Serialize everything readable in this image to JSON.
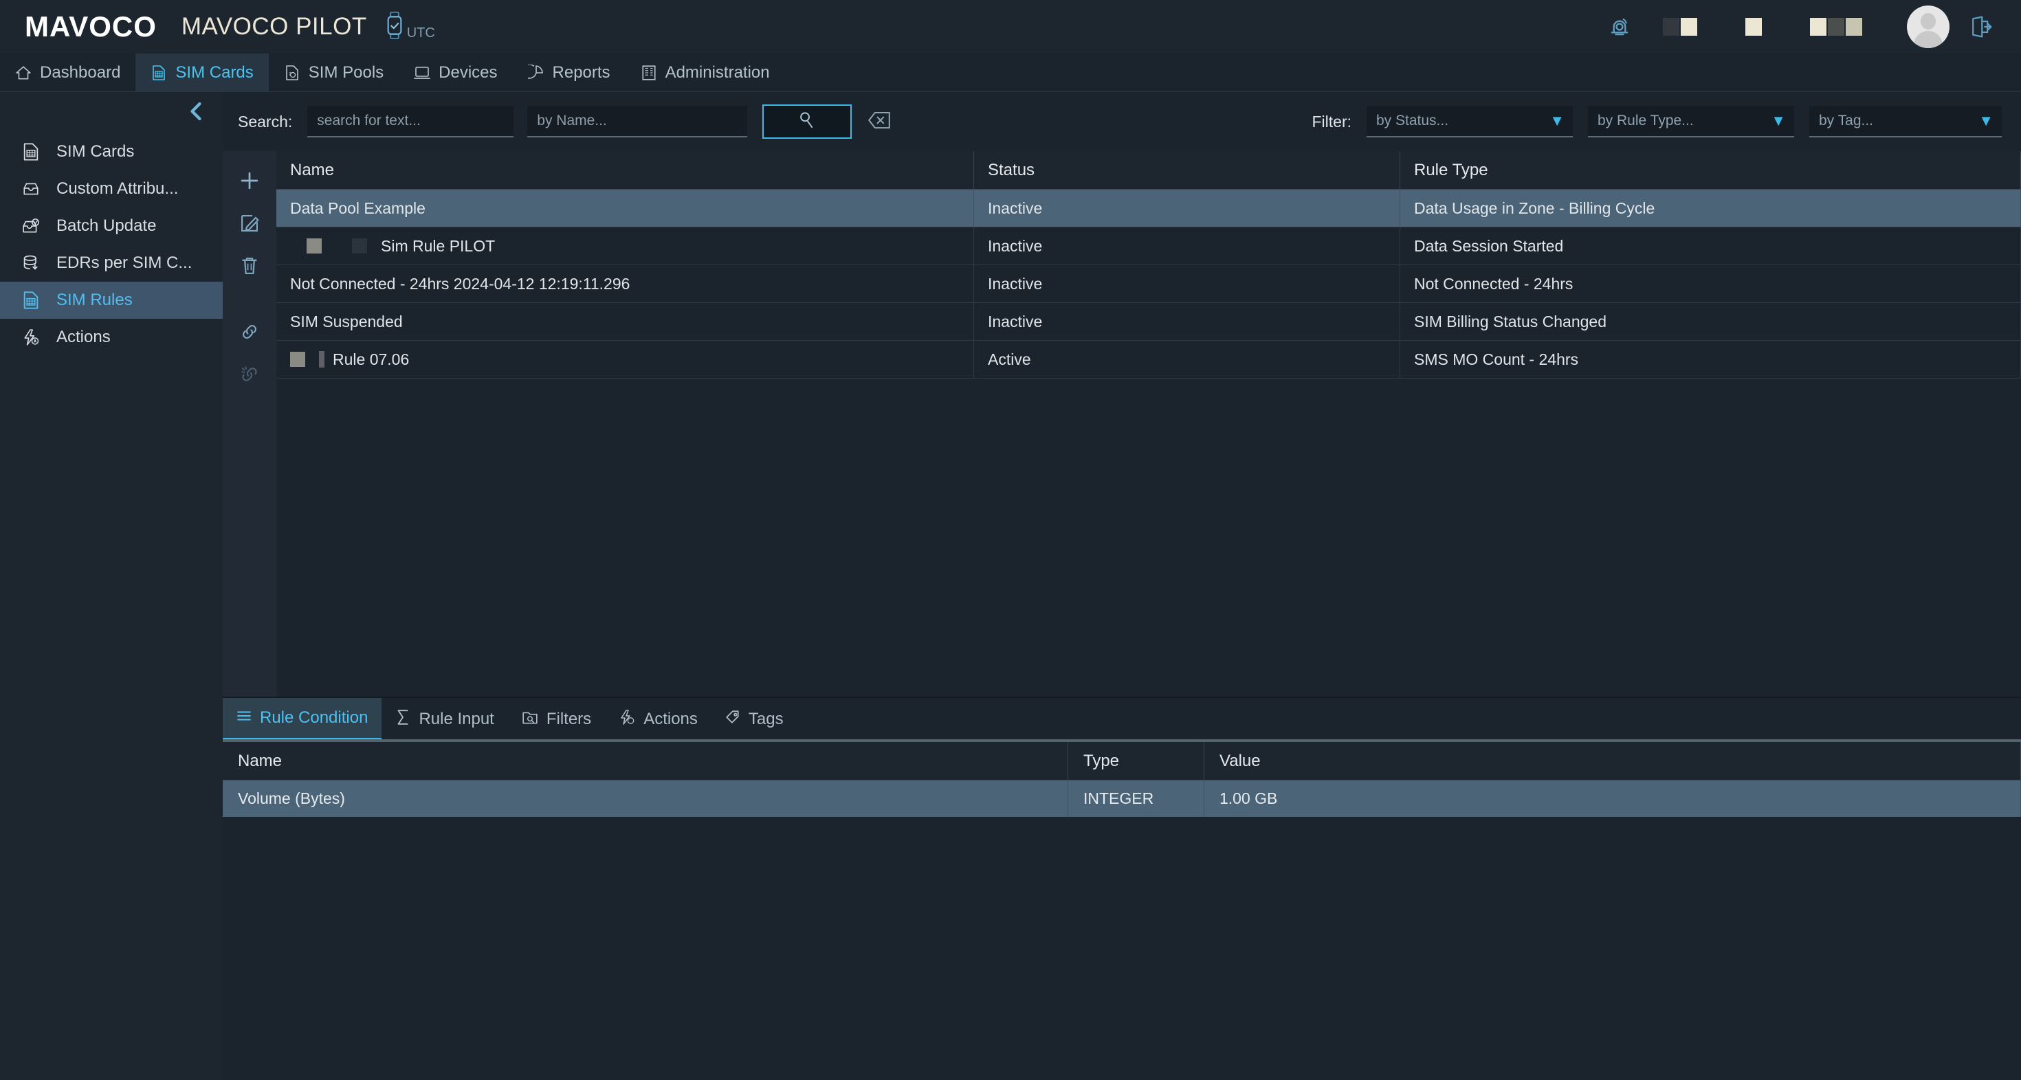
{
  "topbar": {
    "logo": "MAVOCO",
    "app_title": "MAVOCO PILOT",
    "timezone": "UTC",
    "icons": {
      "clock": "watch-utc-icon",
      "bell": "notification-bell-icon",
      "logout": "logout-icon",
      "avatar": "user-avatar"
    },
    "placeholder_glyphs": [
      "■",
      "■",
      "■",
      "■",
      "■",
      "■"
    ]
  },
  "nav": {
    "tabs": [
      {
        "label": "Dashboard",
        "icon": "home-icon",
        "active": false
      },
      {
        "label": "SIM Cards",
        "icon": "sim-card-icon",
        "active": true
      },
      {
        "label": "SIM Pools",
        "icon": "sim-pool-icon",
        "active": false
      },
      {
        "label": "Devices",
        "icon": "device-icon",
        "active": false
      },
      {
        "label": "Reports",
        "icon": "report-icon",
        "active": false
      },
      {
        "label": "Administration",
        "icon": "admin-icon",
        "active": false
      }
    ]
  },
  "sidebar": {
    "collapse_icon": "chevron-left-icon",
    "items": [
      {
        "label": "SIM Cards",
        "icon": "sim-card-icon",
        "active": false
      },
      {
        "label": "Custom Attribu...",
        "icon": "drawer-icon",
        "active": false
      },
      {
        "label": "Batch Update",
        "icon": "batch-update-icon",
        "active": false
      },
      {
        "label": "EDRs per SIM C...",
        "icon": "database-icon",
        "active": false
      },
      {
        "label": "SIM Rules",
        "icon": "sim-rule-icon",
        "active": true
      },
      {
        "label": "Actions",
        "icon": "lightning-icon",
        "active": false
      }
    ]
  },
  "search": {
    "label": "Search:",
    "text_placeholder": "search for text...",
    "text_value": "",
    "name_placeholder": "by Name...",
    "name_value": "",
    "search_button_icon": "search-icon",
    "clear_button_icon": "clear-backspace-icon"
  },
  "filter": {
    "label": "Filter:",
    "selects": [
      {
        "name": "by-status",
        "value": "by Status..."
      },
      {
        "name": "by-rule-type",
        "value": "by Rule Type..."
      },
      {
        "name": "by-tag",
        "value": "by Tag..."
      }
    ]
  },
  "rail": {
    "buttons": [
      {
        "name": "add-button",
        "icon": "plus-icon"
      },
      {
        "name": "edit-button",
        "icon": "edit-pencil-icon"
      },
      {
        "name": "delete-button",
        "icon": "trash-icon"
      },
      {
        "name": "link-button",
        "icon": "link-icon"
      },
      {
        "name": "unlink-button",
        "icon": "unlink-icon"
      }
    ]
  },
  "table": {
    "columns": [
      "Name",
      "Status",
      "Rule Type"
    ],
    "rows": [
      {
        "name": "Data Pool Example",
        "status": "Inactive",
        "type": "Data Usage in Zone - Billing Cycle",
        "selected": true,
        "indent": 0,
        "marker": "none"
      },
      {
        "name": "Sim Rule PILOT",
        "status": "Inactive",
        "type": "Data Session Started",
        "selected": false,
        "indent": 1,
        "marker": "double"
      },
      {
        "name": "Not Connected - 24hrs 2024-04-12 12:19:11.296",
        "status": "Inactive",
        "type": "Not Connected - 24hrs",
        "selected": false,
        "indent": 0,
        "marker": "none"
      },
      {
        "name": "SIM Suspended",
        "status": "Inactive",
        "type": "SIM Billing Status Changed",
        "selected": false,
        "indent": 0,
        "marker": "none"
      },
      {
        "name": "Rule 07.06",
        "status": "Active",
        "type": "SMS MO Count - 24hrs",
        "selected": false,
        "indent": 1,
        "marker": "single"
      }
    ]
  },
  "detail": {
    "tabs": [
      {
        "label": "Rule Condition",
        "icon": "list-lines-icon",
        "active": true
      },
      {
        "label": "Rule Input",
        "icon": "sigma-icon",
        "active": false
      },
      {
        "label": "Filters",
        "icon": "filter-folder-icon",
        "active": false
      },
      {
        "label": "Actions",
        "icon": "lightning-icon",
        "active": false
      },
      {
        "label": "Tags",
        "icon": "tag-icon",
        "active": false
      }
    ],
    "columns": [
      "Name",
      "Type",
      "Value"
    ],
    "rows": [
      {
        "name": "Volume (Bytes)",
        "type": "INTEGER",
        "value": "1.00 GB"
      }
    ]
  },
  "colors": {
    "background": "#1b232c",
    "panel": "#1d252e",
    "accent": "#3bb9e8",
    "accent_text": "#4fc0ef",
    "selected_row": "#4c6478",
    "active_sidebar": "#3e556b",
    "text": "#e0e6ea",
    "muted_text": "#8fa2b1",
    "title_cream": "#ece6d5"
  }
}
